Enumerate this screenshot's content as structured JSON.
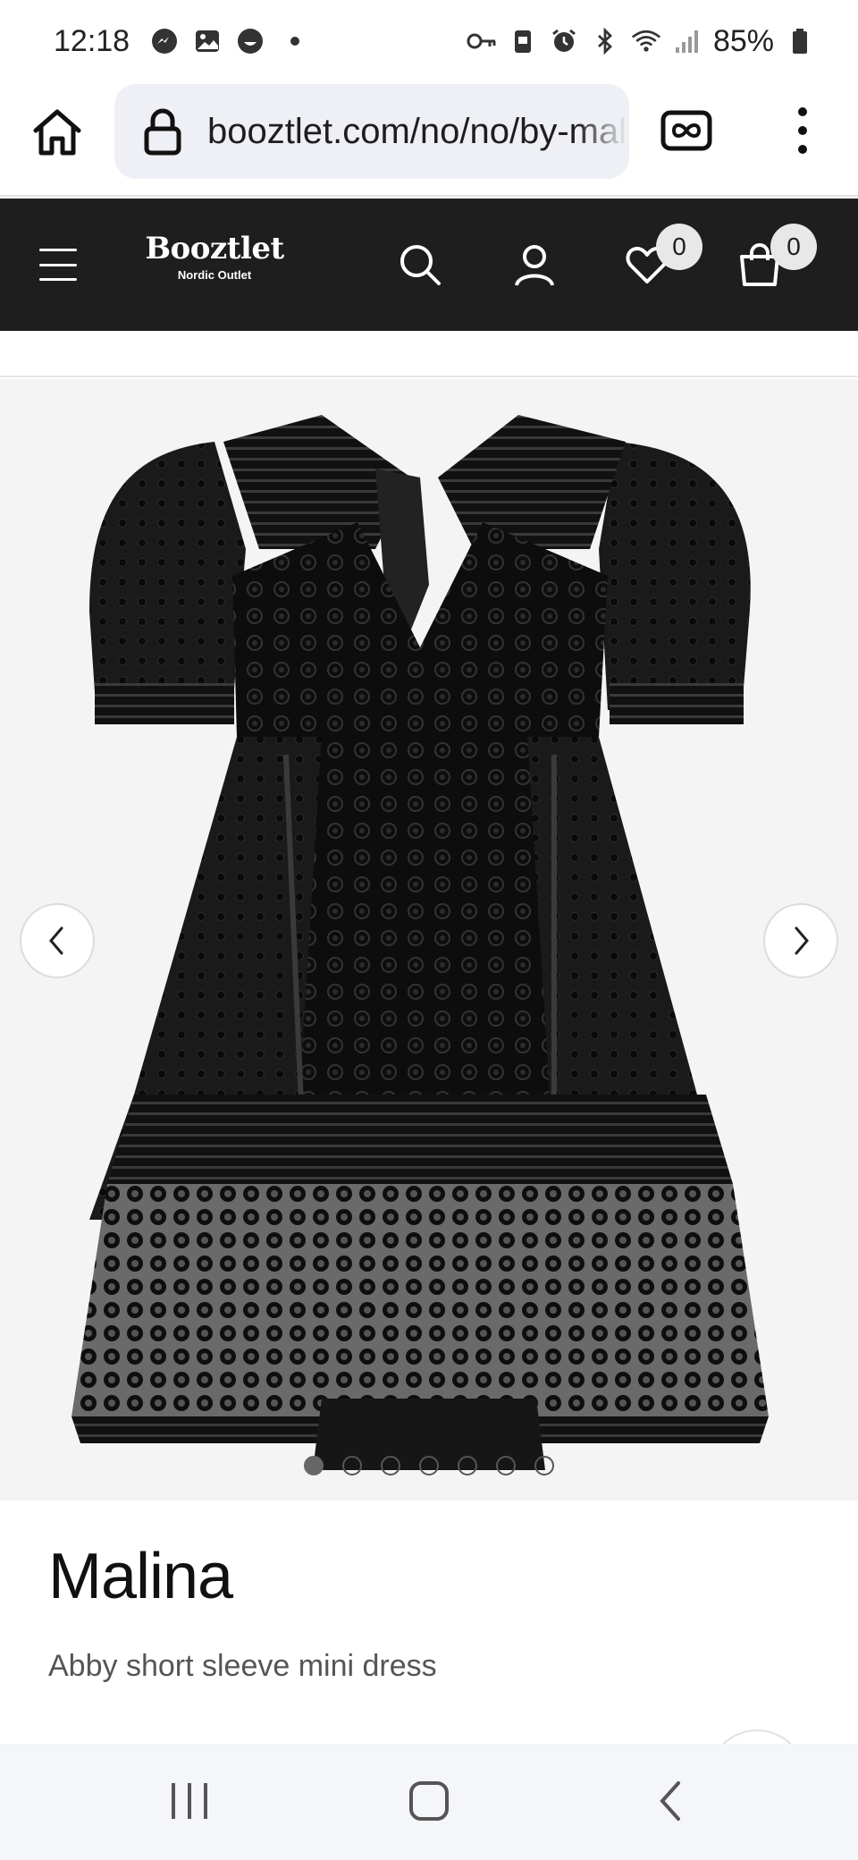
{
  "status_bar": {
    "time": "12:18",
    "battery": "85%",
    "left_icons": [
      "messenger-icon",
      "gallery-icon",
      "emoji-icon"
    ],
    "right_icons": [
      "vpn-key-icon",
      "clipboard-icon",
      "alarm-icon",
      "bluetooth-icon",
      "wifi-icon",
      "signal-icon",
      "battery-icon"
    ]
  },
  "browser": {
    "url": "booztlet.com/no/no/by-malina"
  },
  "site_header": {
    "logo_main": "Booztlet",
    "logo_sub": "Nordic Outlet",
    "wishlist_count": "0",
    "cart_count": "0",
    "background": "#1e1e1e"
  },
  "gallery": {
    "image_alt": "Black lace short sleeve mini dress",
    "slide_count": 7,
    "active_slide": 1
  },
  "product": {
    "brand": "Malina",
    "title": "Abby short sleeve mini dress"
  }
}
